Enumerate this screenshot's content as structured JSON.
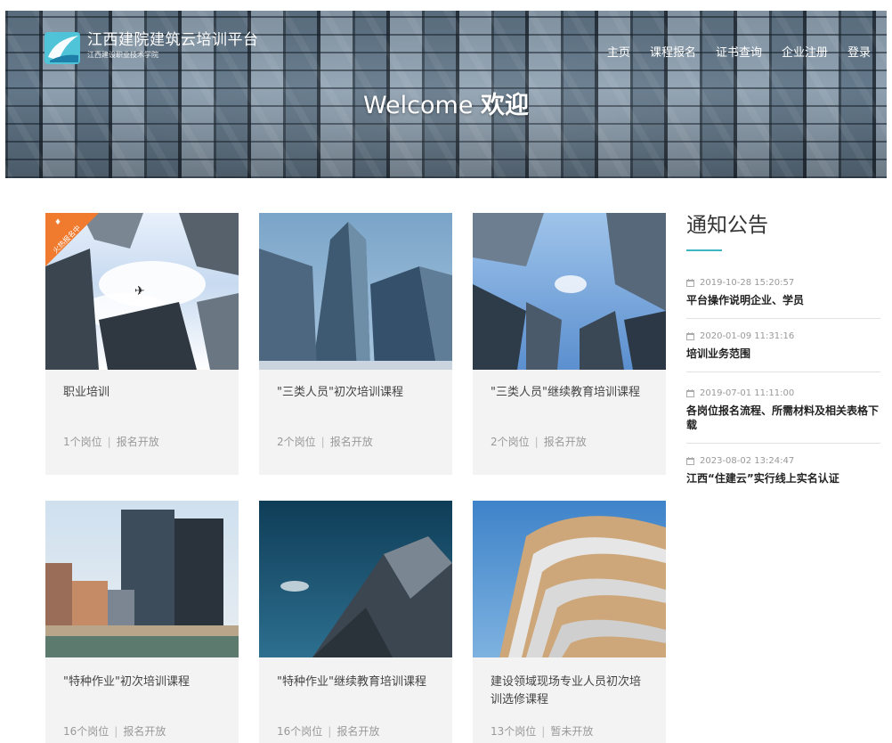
{
  "header": {
    "logo_title": "江西建院建筑云培训平台",
    "logo_subtitle": "江西建设职业技术学院",
    "nav": [
      "主页",
      "课程报名",
      "证书查询",
      "企业注册",
      "登录"
    ],
    "welcome_en": "Welcome",
    "welcome_zh": "欢迎"
  },
  "courses": [
    {
      "title": "职业培训",
      "positions": "1个岗位",
      "status": "报名开放",
      "ribbon": "火热报名中"
    },
    {
      "title": "\"三类人员\"初次培训课程",
      "positions": "2个岗位",
      "status": "报名开放"
    },
    {
      "title": "\"三类人员\"继续教育培训课程",
      "positions": "2个岗位",
      "status": "报名开放"
    },
    {
      "title": "\"特种作业\"初次培训课程",
      "positions": "16个岗位",
      "status": "报名开放"
    },
    {
      "title": "\"特种作业\"继续教育培训课程",
      "positions": "16个岗位",
      "status": "报名开放"
    },
    {
      "title": "建设领域现场专业人员初次培训选修课程",
      "positions": "13个岗位",
      "status": "暂未开放"
    }
  ],
  "notices": {
    "heading": "通知公告",
    "items": [
      {
        "date": "2019-10-28 15:20:57",
        "title": "平台操作说明企业、学员"
      },
      {
        "date": "2020-01-09 11:31:16",
        "title": "培训业务范围"
      },
      {
        "date": "2019-07-01 11:11:00",
        "title": "各岗位报名流程、所需材料及相关表格下载"
      },
      {
        "date": "2023-08-02 13:24:47",
        "title": "江西“住建云”实行线上实名认证"
      }
    ]
  },
  "colors": {
    "accent": "#3cb5c5",
    "ribbon": "#f07a2e",
    "card_bg": "#f3f3f3"
  }
}
